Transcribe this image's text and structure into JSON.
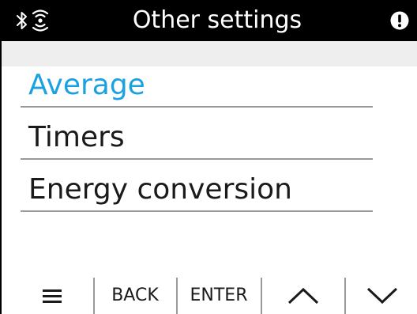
{
  "header": {
    "title": "Other settings",
    "icons": [
      "bluetooth-icon",
      "wireless-signal-icon",
      "alert-icon"
    ]
  },
  "menu": {
    "items": [
      {
        "label": "Average",
        "selected": true
      },
      {
        "label": "Timers",
        "selected": false
      },
      {
        "label": "Energy conversion",
        "selected": false
      }
    ]
  },
  "softkeys": {
    "menu_icon": "hamburger-menu-icon",
    "back_label": "BACK",
    "enter_label": "ENTER",
    "up_icon": "chevron-up-icon",
    "down_icon": "chevron-down-icon"
  },
  "colors": {
    "header_bg": "#000000",
    "accent": "#1ba1e2",
    "text": "#1a1a1a",
    "divider": "#999999"
  }
}
